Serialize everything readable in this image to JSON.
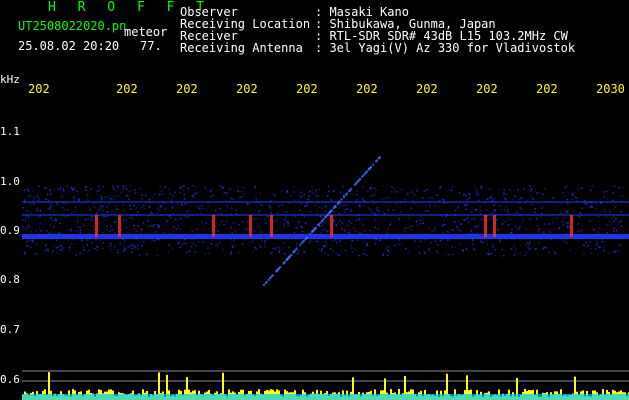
{
  "header": {
    "title": "H R O F F T",
    "filename": "UT2508022020.pn",
    "type_label": "meteor",
    "datetime": "25.08.02 20:20",
    "count": "77."
  },
  "info": [
    {
      "label": "Observer",
      "value": ": Masaki Kano"
    },
    {
      "label": "Receiving Location",
      "value": ": Shibukawa, Gunma, Japan"
    },
    {
      "label": "Receiver",
      "value": ": RTL-SDR SDR# 43dB L15 103.2MHz CW"
    },
    {
      "label": "Receiving Antenna",
      "value": ": 3el Yagi(V) Az 330 for Vladivostok"
    }
  ],
  "axis": {
    "y_unit": "kHz",
    "y_ticks": [
      "1.1",
      "1.0",
      "0.9",
      "0.8",
      "0.7",
      "0.6"
    ],
    "time_ticks": [
      "202",
      "202",
      "202",
      "202",
      "202",
      "202",
      "202",
      "202",
      "202",
      "2030"
    ]
  },
  "colors": {
    "background": "#000000",
    "header_title": "#00ff00",
    "header_text": "#ffffff",
    "time_ticks": "#ffff00",
    "spectrum_blue": "#1e3cff",
    "spectrum_hot": "#ff3030",
    "power_trace": "#ffff00",
    "power_base": "#00c8ff"
  }
}
